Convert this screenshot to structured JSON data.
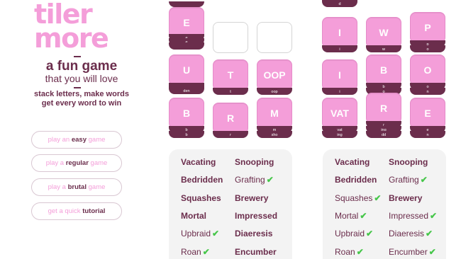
{
  "brand": {
    "logo_line1": "tiler",
    "logo_line2": "more",
    "tagline_1": "a fun game",
    "tagline_2": "that you will love",
    "tagline_3a": "stack letters, make words",
    "tagline_3b": "get every word to win"
  },
  "menu": {
    "easy": {
      "pre": "play an",
      "strong": "easy",
      "post": "game"
    },
    "regular": {
      "pre": "play a",
      "strong": "regular",
      "post": "game"
    },
    "brutal": {
      "pre": "play a",
      "strong": "brutal",
      "post": "game"
    },
    "tutorial": {
      "pre": "get a quick",
      "strong": "tutorial",
      "post": ""
    }
  },
  "colors": {
    "tile": "#f49ed9",
    "layer": "#6b2d4c",
    "text": "#6b2d4c",
    "check": "#46c64a"
  },
  "board1": {
    "top_cut_label": "",
    "stacks": [
      {
        "letters": "E",
        "sub": [
          "",
          "e",
          "e"
        ]
      },
      {
        "letters": "U",
        "sub": [
          "den"
        ]
      },
      {
        "letters": "T",
        "sub": [
          "t"
        ]
      },
      {
        "letters": "OOP",
        "sub": [
          "oop"
        ]
      },
      {
        "letters": "B",
        "sub": [
          "b",
          "b"
        ]
      },
      {
        "letters": "R",
        "sub": [
          "r"
        ]
      },
      {
        "letters": "M",
        "sub": [
          "m",
          "sho"
        ]
      }
    ]
  },
  "board2": {
    "top_cut_label": "d",
    "stacks": [
      {
        "letters": "I",
        "sub": [
          "i"
        ]
      },
      {
        "letters": "W",
        "sub": [
          "w"
        ]
      },
      {
        "letters": "P",
        "sub": [
          "p",
          "o"
        ]
      },
      {
        "letters": "I",
        "sub": [
          "i"
        ]
      },
      {
        "letters": "B",
        "sub": [
          "b",
          "o"
        ]
      },
      {
        "letters": "O",
        "sub": [
          "o",
          "n"
        ]
      },
      {
        "letters": "VAT",
        "sub": [
          "vat",
          "ing"
        ]
      },
      {
        "letters": "R",
        "sub": [
          "r",
          "ing",
          "dd"
        ]
      },
      {
        "letters": "E",
        "sub": [
          "e",
          "n"
        ]
      }
    ]
  },
  "words1": [
    {
      "text": "Vacating",
      "found": false
    },
    {
      "text": "Bedridden",
      "found": false
    },
    {
      "text": "Squashes",
      "found": false
    },
    {
      "text": "Mortal",
      "found": false
    },
    {
      "text": "Upbraid",
      "found": true
    },
    {
      "text": "Roan",
      "found": true
    },
    {
      "text": "Snooping",
      "found": false
    },
    {
      "text": "Grafting",
      "found": true
    },
    {
      "text": "Brewery",
      "found": false
    },
    {
      "text": "Impressed",
      "found": false
    },
    {
      "text": "Diaeresis",
      "found": false
    },
    {
      "text": "Encumber",
      "found": false
    }
  ],
  "words2": [
    {
      "text": "Vacating",
      "found": false
    },
    {
      "text": "Bedridden",
      "found": false
    },
    {
      "text": "Squashes",
      "found": true
    },
    {
      "text": "Mortal",
      "found": true
    },
    {
      "text": "Upbraid",
      "found": true
    },
    {
      "text": "Roan",
      "found": true
    },
    {
      "text": "Snooping",
      "found": false
    },
    {
      "text": "Grafting",
      "found": true
    },
    {
      "text": "Brewery",
      "found": false
    },
    {
      "text": "Impressed",
      "found": true
    },
    {
      "text": "Diaeresis",
      "found": true
    },
    {
      "text": "Encumber",
      "found": true
    }
  ],
  "check_mark": "✔"
}
